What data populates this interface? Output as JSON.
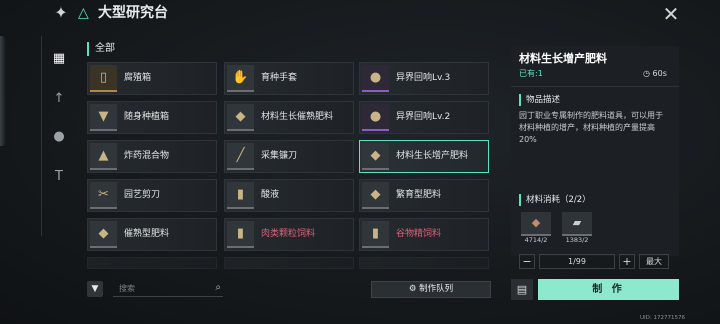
{
  "header": {
    "menu_icon": "four-point-star-icon",
    "title_icon": "triangle-icon",
    "title": "大型研究台",
    "close_icon": "close-icon"
  },
  "rail": [
    {
      "icon": "grid-icon",
      "active": true
    },
    {
      "icon": "sword-icon",
      "active": false
    },
    {
      "icon": "grenade-icon",
      "active": false
    },
    {
      "icon": "hammer-icon",
      "active": false
    }
  ],
  "category_label": "全部",
  "items": [
    {
      "label": "腐殖箱",
      "icon": "box-icon",
      "rarity": "gold",
      "glyph": "▯"
    },
    {
      "label": "育种手套",
      "icon": "gloves-icon",
      "rarity": "grey",
      "glyph": "✋"
    },
    {
      "label": "异界回响Lv.3",
      "icon": "orb-icon",
      "rarity": "purple",
      "glyph": "●"
    },
    {
      "label": "随身种植箱",
      "icon": "planter-icon",
      "rarity": "grey",
      "glyph": "▼"
    },
    {
      "label": "材料生长催熟肥料",
      "icon": "fertilizer-bag-icon",
      "rarity": "grey",
      "glyph": "◆"
    },
    {
      "label": "异界回响Lv.2",
      "icon": "orb-icon",
      "rarity": "purple",
      "glyph": "●"
    },
    {
      "label": "炸药混合物",
      "icon": "explosive-mix-icon",
      "rarity": "grey",
      "glyph": "▲"
    },
    {
      "label": "采集镰刀",
      "icon": "sickle-icon",
      "rarity": "grey",
      "glyph": "╱"
    },
    {
      "label": "材料生长增产肥料",
      "icon": "fertilizer-bag-icon",
      "rarity": "grey",
      "glyph": "◆",
      "selected": true
    },
    {
      "label": "园艺剪刀",
      "icon": "scissors-icon",
      "rarity": "grey",
      "glyph": "✂"
    },
    {
      "label": "酸液",
      "icon": "acid-flask-icon",
      "rarity": "grey",
      "glyph": "▮"
    },
    {
      "label": "繁育型肥料",
      "icon": "fertilizer-sack-icon",
      "rarity": "grey",
      "glyph": "◆"
    },
    {
      "label": "催熟型肥料",
      "icon": "fertilizer-bag-icon",
      "rarity": "grey",
      "glyph": "◆"
    },
    {
      "label": "肉类颗粒饲料",
      "icon": "feed-bag-icon",
      "rarity": "grey",
      "glyph": "▮",
      "pink": true
    },
    {
      "label": "谷物精饲料",
      "icon": "feed-bag-icon",
      "rarity": "grey",
      "glyph": "▮",
      "pink": true
    }
  ],
  "search": {
    "placeholder": "搜索",
    "icon": "search-icon"
  },
  "filter_icon": "filter-icon",
  "queue_button": {
    "icon": "gear-icon",
    "label": "制作队列"
  },
  "detail": {
    "name": "材料生长增产肥料",
    "have": "已有:1",
    "timer_icon": "clock-icon",
    "time": "60s",
    "desc_heading": "物品描述",
    "description": "园丁职业专属制作的肥料道具，可以用于材料种植的增产，材料种植的产量提高20%",
    "materials_heading": "材料消耗（2/2）",
    "materials": [
      {
        "icon": "ore-icon",
        "count": "4714/2"
      },
      {
        "icon": "ingot-icon",
        "count": "1383/2"
      }
    ],
    "quantity": "1/99",
    "max_label": "最大",
    "craft_label": "制 作",
    "doc_icon": "recipe-doc-icon"
  },
  "uid": "UID: 172771576",
  "colors": {
    "accent": "#5fe0c2",
    "craft_button": "#8ee8cc",
    "pink_text": "#e0607a"
  }
}
